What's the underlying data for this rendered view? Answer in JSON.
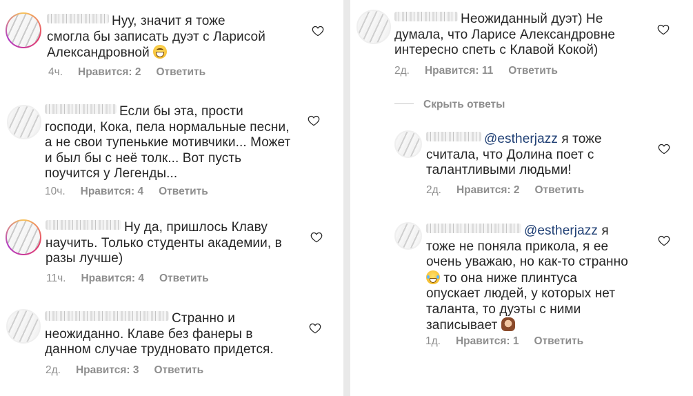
{
  "labels": {
    "likes_prefix": "Нравится: ",
    "reply": "Ответить",
    "hide_replies": "Скрыть ответы"
  },
  "comments": [
    {
      "text": "Нуу, значит я тоже смогла бы записать дуэт с Ларисой Александровной",
      "emoji": "grinning-sweat-emoji",
      "time": "4ч.",
      "likes": "Нравится: 2"
    },
    {
      "text": "Если бы эта, прости господи, Кока, пела нормальные песни, а не свои тупенькие мотивчики... Может и был бы с неё толк... Вот пусть поучится у Легенды...",
      "time": "10ч.",
      "likes": "Нравится: 4"
    },
    {
      "text": "Ну да, пришлось Клаву научить. Только студенты академии, в разы лучше)",
      "time": "11ч.",
      "likes": "Нравится: 4"
    },
    {
      "text": "Странно и неожиданно. Клаве без фанеры в данном случае трудновато придется.",
      "time": "2д.",
      "likes": "Нравится: 3"
    },
    {
      "text": "Неожиданный дуэт) Не думала, что Ларисе Александровне интересно спеть с Клавой Кокой)",
      "time": "2д.",
      "likes": "Нравится: 11"
    }
  ],
  "replies": [
    {
      "mention": "@estherjazz",
      "text": " я тоже считала, что Долина поет с талантливыми людьми!",
      "time": "2д.",
      "likes": "Нравится: 2"
    },
    {
      "mention": "@estherjazz",
      "text_a": " я тоже не поняла прикола, я ее очень уважаю, но как-то странно",
      "text_b": " то она ниже плинтуса опускает людей, у которых нет таланта, то дуэты с ними записывает",
      "emoji_a": "tears-of-joy-emoji",
      "emoji_b": "facepalm-emoji",
      "time": "1д.",
      "likes": "Нравится: 1"
    }
  ],
  "colors": {
    "text": "#262626",
    "meta": "#8e8e8e",
    "mention": "#1f3f74",
    "divider": "#e9e9e9"
  }
}
